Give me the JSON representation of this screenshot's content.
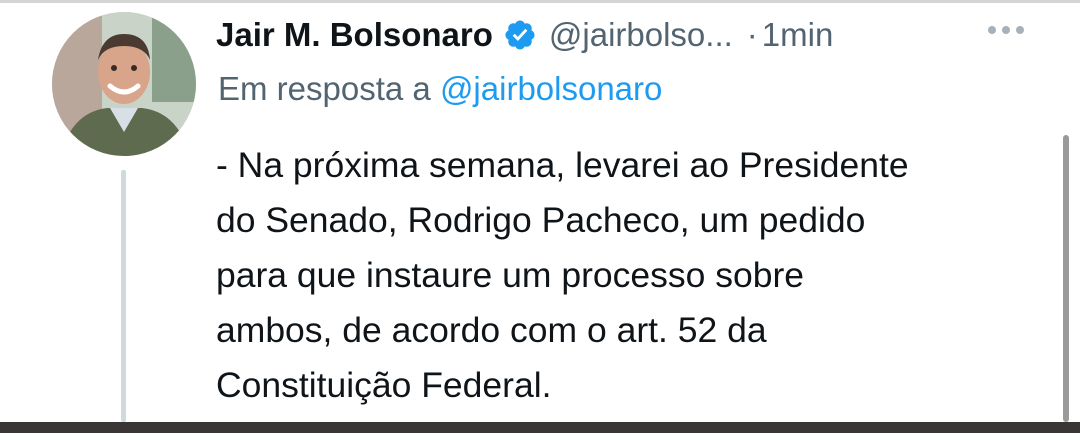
{
  "tweet": {
    "author_name": "Jair M. Bolsonaro",
    "handle": "@jairbolso...",
    "separator": "·",
    "time": "1min",
    "reply_prefix": "Em resposta a",
    "reply_handle": "@jairbolsonaro",
    "text": "- Na próxima semana, levarei ao Presidente\ndo Senado, Rodrigo Pacheco, um pedido\npara que instaure um processo sobre\nambos, de acordo com o art. 52 da\nConstituição Federal."
  },
  "icons": {
    "verified": "verified-badge-icon",
    "more": "more-options-icon"
  },
  "colors": {
    "text": "#0f1419",
    "secondary": "#536471",
    "accent": "#1d9bf0"
  }
}
